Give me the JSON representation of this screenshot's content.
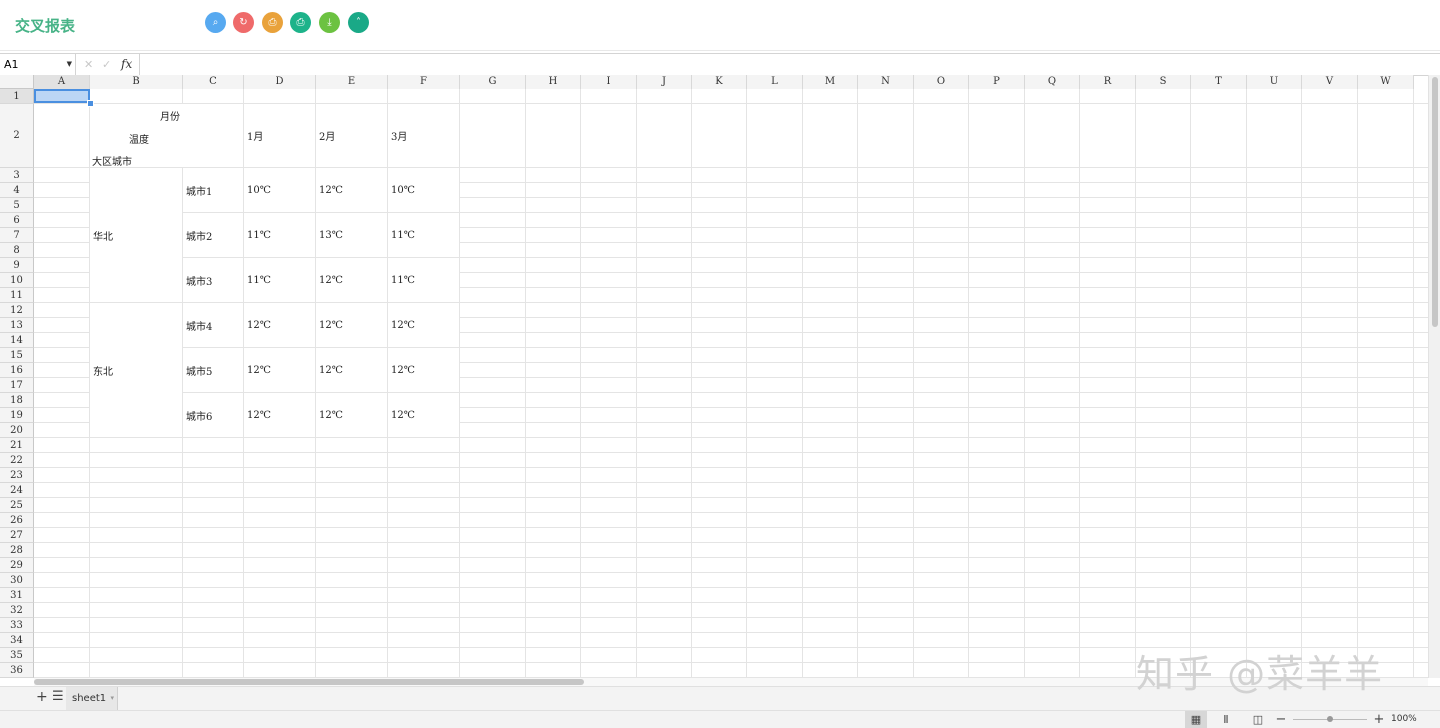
{
  "app": {
    "title": "交叉报表"
  },
  "toolbar": {
    "buttons": [
      {
        "name": "search-icon",
        "glyph": "⌕",
        "color": "#57a9f0"
      },
      {
        "name": "refresh-icon",
        "glyph": "↻",
        "color": "#ef6a6a"
      },
      {
        "name": "print-icon",
        "glyph": "⎙",
        "color": "#e9a23b"
      },
      {
        "name": "print-settings-icon",
        "glyph": "⎙",
        "color": "#1db38a"
      },
      {
        "name": "download-icon",
        "glyph": "⤓",
        "color": "#6cc241"
      },
      {
        "name": "collapse-icon",
        "glyph": "˄",
        "color": "#1aa987"
      }
    ]
  },
  "formula_bar": {
    "cell_ref": "A1",
    "formula": "",
    "fx_label": "fx",
    "cancel_glyph": "✕",
    "confirm_glyph": "✓"
  },
  "sheet": {
    "columns": [
      "A",
      "B",
      "C",
      "D",
      "E",
      "F",
      "G",
      "H",
      "I",
      "J",
      "K",
      "L",
      "M",
      "N",
      "O",
      "P",
      "Q",
      "R",
      "S",
      "T",
      "U",
      "V",
      "W"
    ],
    "rows": [
      "1",
      "2",
      "3",
      "4",
      "5",
      "6",
      "7",
      "8",
      "9",
      "10",
      "11",
      "12",
      "13",
      "14",
      "15",
      "16",
      "17",
      "18",
      "19",
      "20",
      "21",
      "22",
      "23",
      "24",
      "25",
      "26",
      "27",
      "28",
      "29",
      "30",
      "31",
      "32",
      "33",
      "34",
      "35",
      "36"
    ],
    "selected_cell": "A1",
    "header": {
      "month_label": "月份",
      "temp_label": "温度",
      "region_city_label": "大区城市",
      "months": [
        "1月",
        "2月",
        "3月"
      ]
    },
    "regions": [
      {
        "name": "华北",
        "cities": [
          {
            "name": "城市1",
            "values": [
              "10℃",
              "12℃",
              "10℃"
            ]
          },
          {
            "name": "城市2",
            "values": [
              "11℃",
              "13℃",
              "11℃"
            ]
          },
          {
            "name": "城市3",
            "values": [
              "11℃",
              "12℃",
              "11℃"
            ]
          }
        ]
      },
      {
        "name": "东北",
        "cities": [
          {
            "name": "城市4",
            "values": [
              "12℃",
              "12℃",
              "12℃"
            ]
          },
          {
            "name": "城市5",
            "values": [
              "12℃",
              "12℃",
              "12℃"
            ]
          },
          {
            "name": "城市6",
            "values": [
              "12℃",
              "12℃",
              "12℃"
            ]
          }
        ]
      }
    ]
  },
  "sheet_tabs": {
    "add_glyph": "+",
    "list_glyph": "☰",
    "tabs": [
      "sheet1"
    ],
    "dropdown_glyph": "▾"
  },
  "status_bar": {
    "view_normal_glyph": "▦",
    "view_page_break_glyph": "Ⅱ",
    "view_page_layout_glyph": "◫",
    "zoom_out_glyph": "−",
    "zoom_in_glyph": "+",
    "zoom": "100%",
    "zoom_fraction": 0.5
  },
  "watermark": "知乎 @菜羊羊"
}
